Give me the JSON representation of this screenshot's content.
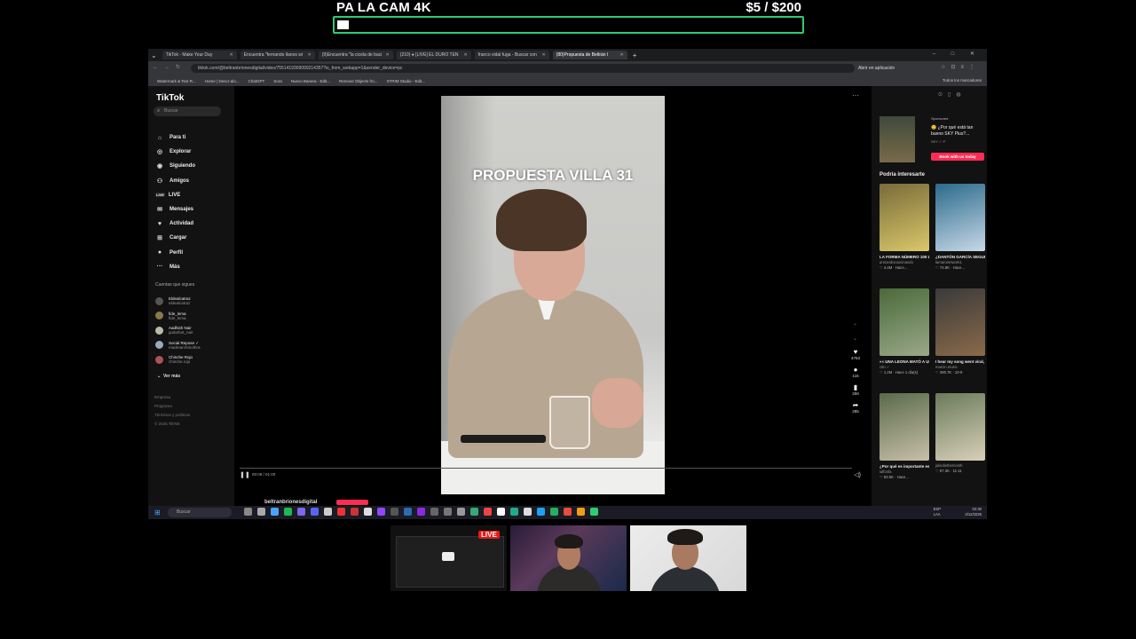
{
  "overlay": {
    "goal_title": "PA LA CAM 4K",
    "goal_amount": "$5  / $200",
    "goal_progress_fraction": 0.025,
    "accent_color": "#2ecc71"
  },
  "browser": {
    "tabs": [
      {
        "label": "TikTok - Make Your Day",
        "active": false
      },
      {
        "label": "Encuentra \"fernando llanos wi",
        "active": false
      },
      {
        "label": "(9)Encuentra \"la cicela de baci",
        "active": false
      },
      {
        "label": "(210) ● [LIVE] EL DURO TEN",
        "active": false
      },
      {
        "label": "franco vidal fuga - Buscar con",
        "active": false
      },
      {
        "label": "(80)Propuesta de Beltrán I",
        "active": true
      }
    ],
    "url": "tiktok.com/@beltranbrionesdigital/video/7551419369099214357?is_from_webapp=1&sender_device=pc",
    "open_app_label": "Abrir en aplicación",
    "bookmarks": [
      "Watermark & Text R...",
      "Home | Descr-alo...",
      "ChatGPT",
      "Sora",
      "Nuevo Banera - Edit...",
      "Remove Objects fro...",
      "XTRIM Studio - Edit..."
    ],
    "bookmarks_right": "Todos los marcadores"
  },
  "tiktok": {
    "logo": "TikTok",
    "search_placeholder": "Buscar",
    "nav": [
      {
        "icon": "home-icon",
        "glyph": "⌂",
        "label": "Para ti"
      },
      {
        "icon": "compass-icon",
        "glyph": "◎",
        "label": "Explorar"
      },
      {
        "icon": "following-icon",
        "glyph": "◉",
        "label": "Siguiendo"
      },
      {
        "icon": "friends-icon",
        "glyph": "⚇",
        "label": "Amigos"
      },
      {
        "icon": "live-icon",
        "glyph": "LIVE",
        "label": "LIVE"
      },
      {
        "icon": "messages-icon",
        "glyph": "✉",
        "label": "Mensajes"
      },
      {
        "icon": "activity-icon",
        "glyph": "♥",
        "label": "Actividad"
      },
      {
        "icon": "upload-icon",
        "glyph": "⊞",
        "label": "Cargar"
      },
      {
        "icon": "profile-icon",
        "glyph": "●",
        "label": "Perfil"
      },
      {
        "icon": "more-icon",
        "glyph": "···",
        "label": "Más"
      }
    ],
    "following_title": "Cuentas que sigues",
    "accounts": [
      {
        "name": "Eldealcatraz",
        "handle": "eldealcatraz"
      },
      {
        "name": "fide_lema",
        "handle": "fide_lema"
      },
      {
        "name": "Aadhish Nair",
        "handle": "guitarbot_nair"
      },
      {
        "name": "Social Repose ✓",
        "handle": "madrearchmothra"
      },
      {
        "name": "Chinche Rojo",
        "handle": "chinche.rojo"
      }
    ],
    "see_more": "Ver más",
    "footer": [
      "Empresa",
      "Programa",
      "Términos y políticas",
      "© 2025 TikTok"
    ],
    "video": {
      "caption": "PROPUESTA VILLA 31",
      "time": "00:08 / 01:00",
      "likes": "4763",
      "comments": "116",
      "saves": "258",
      "shares": "285",
      "author": "beltranbrionesdigital"
    },
    "sidebar_right": {
      "sponsored": "Sponsored",
      "ad_text": "😊 ¿Por qué está tan bueno SKY Plus?...",
      "ad_sub": "SKY ✓ P",
      "ad_button": "Book with us today",
      "might_like": "Podría interesarte",
      "cards": [
        {
          "title": "LA FORMA NÚMERO 100 Llegamos... por...",
          "author": "armandocoocinando",
          "stats": "♡ 4.4M · Hace...",
          "color1": "#7a6b3a",
          "color2": "#d9c86a"
        },
        {
          "title": "¿DANTÓN GARCÍA SEGUIRÁ EL CAMIN...",
          "author": "lamaronetwork1",
          "stats": "♡ 74.8K · Hace...",
          "color1": "#2a6a8a",
          "color2": "#c8d8e8"
        },
        {
          "title": "«« UNA LEONA MATÓ A UN HOMBRE EN...",
          "author": "c5n ✓",
          "stats": "♡ 1.2M · Hace 1 día(s)",
          "color1": "#4a6a3a",
          "color2": "#9aa88a"
        },
        {
          "title": "I hear my song went viral, here's how to...",
          "author": "marcin.music",
          "stats": "♡ 390.7K · 10-9",
          "color1": "#3a3a3a",
          "color2": "#8a6a4a"
        },
        {
          "title": "¿Por qué es importante estudiar...",
          "author": "ialfonfa",
          "stats": "♡ 83.5K · Hace...",
          "color1": "#5a6a4a",
          "color2": "#c8c0a8"
        },
        {
          "title": "",
          "author": "juliediethemonth",
          "stats": "♡ 67.3K · 11-11",
          "color1": "#6a7a5a",
          "color2": "#d8d0b8"
        }
      ]
    }
  },
  "taskbar": {
    "search_placeholder": "Buscar",
    "lang": "ESP\nLAA",
    "time": "02:30",
    "date": "3/12/2025"
  },
  "cams": {
    "live_badge": "LIVE"
  }
}
